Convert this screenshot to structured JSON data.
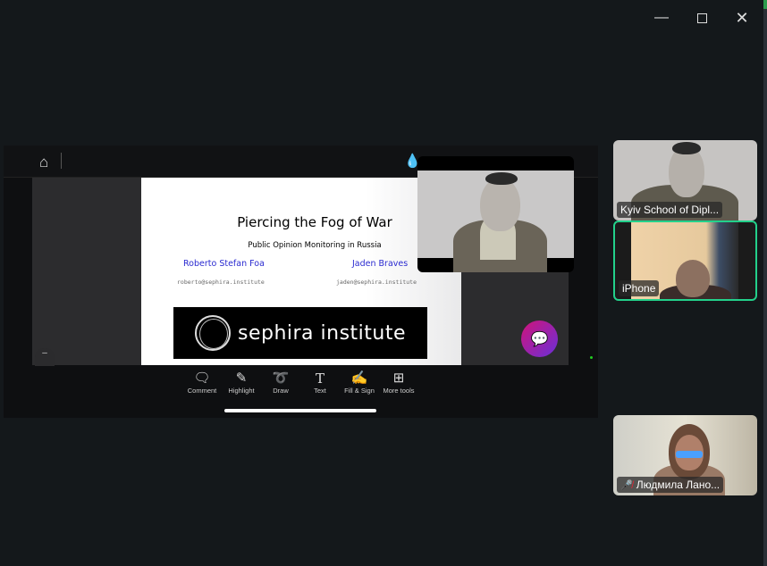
{
  "window": {
    "minimize_icon": "minimize-icon",
    "maximize_icon": "maximize-icon",
    "close_icon": "close-icon"
  },
  "share": {
    "toolbar": {
      "home_icon": "home-icon"
    },
    "slide": {
      "title": "Piercing the Fog of War",
      "subtitle": "Public Opinion Monitoring in Russia",
      "author1": "Roberto Stefan Foa",
      "email1": "roberto@sephira.institute",
      "author2": "Jaden Braves",
      "email2": "jaden@sephira.institute",
      "logo_text": "sephira institute"
    },
    "tools": [
      {
        "label": "Comment",
        "icon": "comment-icon"
      },
      {
        "label": "Highlight",
        "icon": "highlight-icon"
      },
      {
        "label": "Draw",
        "icon": "draw-icon"
      },
      {
        "label": "Text",
        "icon": "text-icon"
      },
      {
        "label": "Fill & Sign",
        "icon": "fill-sign-icon"
      },
      {
        "label": "More tools",
        "icon": "more-tools-icon"
      }
    ]
  },
  "participants": [
    {
      "name": "Kyiv School of Dipl..."
    },
    {
      "name": "iPhone",
      "active_speaker": true
    },
    {
      "name": "Людмила Лано...",
      "muted": true
    }
  ],
  "colors": {
    "background": "#14181b",
    "active_speaker_border": "#23d18b",
    "slide_author": "#2a2ad0"
  }
}
